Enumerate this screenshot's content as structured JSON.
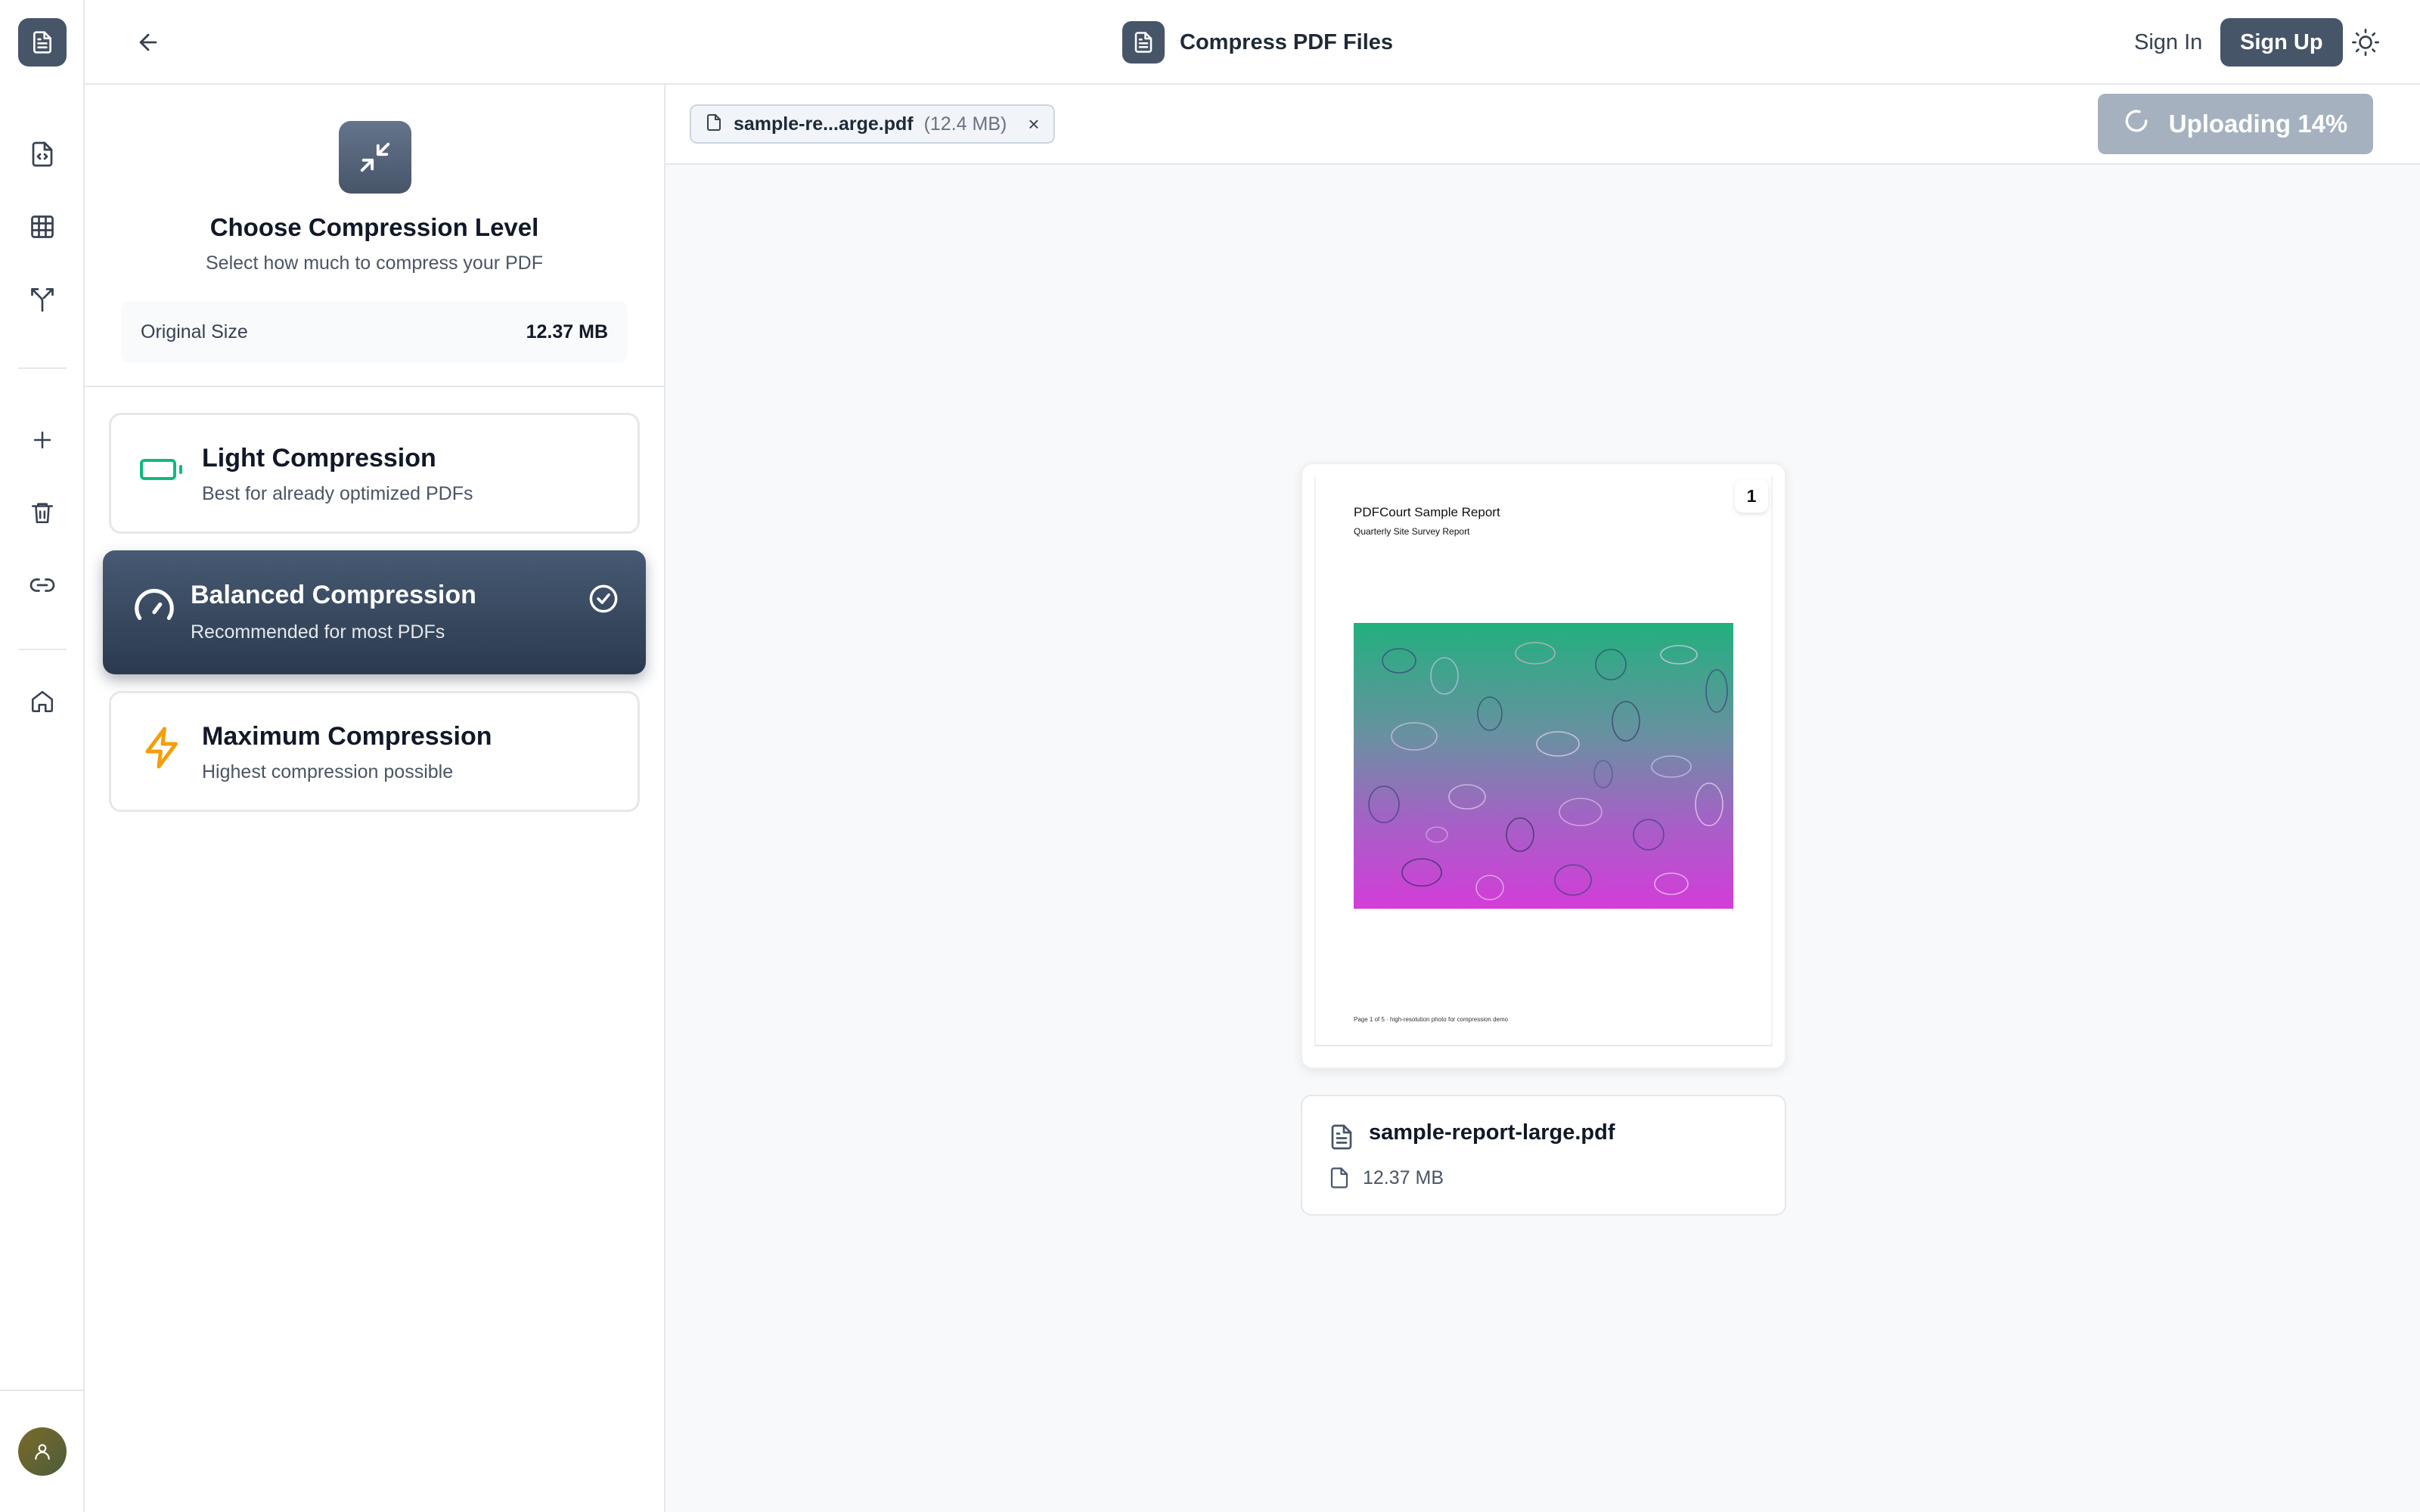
{
  "header": {
    "title": "Compress PDF Files",
    "sign_in": "Sign In",
    "sign_up": "Sign Up"
  },
  "rail": {
    "items": [
      {
        "name": "file-code-icon"
      },
      {
        "name": "grid-icon"
      },
      {
        "name": "merge-arrow-icon"
      },
      {
        "name": "plus-icon"
      },
      {
        "name": "trash-icon"
      },
      {
        "name": "link-icon"
      },
      {
        "name": "home-icon"
      }
    ]
  },
  "panel": {
    "title": "Choose Compression Level",
    "subtitle": "Select how much to compress your PDF",
    "original_size_label": "Original Size",
    "original_size_value": "12.37 MB",
    "options": [
      {
        "title": "Light Compression",
        "desc": "Best for already optimized PDFs",
        "icon": "battery-icon",
        "color": "#10b981"
      },
      {
        "title": "Balanced Compression",
        "desc": "Recommended for most PDFs",
        "icon": "gauge-icon",
        "selected": true
      },
      {
        "title": "Maximum Compression",
        "desc": "Highest compression possible",
        "icon": "lightning-icon",
        "color": "#f59e0b"
      }
    ]
  },
  "file_chip": {
    "name": "sample-re...arge.pdf",
    "size": "(12.4 MB)",
    "remove": "×"
  },
  "upload": {
    "label": "Uploading 14%",
    "progress": 0.14
  },
  "preview": {
    "page_number": "1",
    "doc_title": "PDFCourt Sample Report",
    "doc_subtitle": "Quarterly Site Survey Report",
    "doc_footer": "Page 1 of 5 · high-resolution photo for compression demo"
  },
  "file_info": {
    "filename": "sample-report-large.pdf",
    "size": "12.37 MB"
  },
  "colors": {
    "brand": "#475569",
    "selected_card": "#3b4a5e",
    "upload_disabled": "#a5b1bf"
  }
}
